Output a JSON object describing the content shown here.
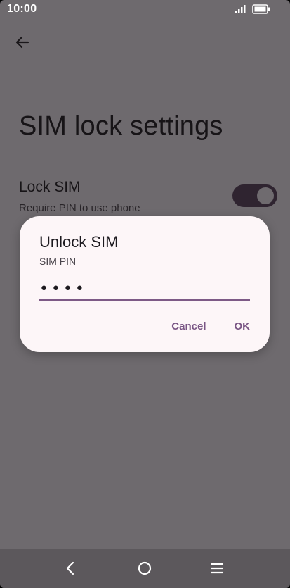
{
  "status_bar": {
    "time": "10:00",
    "icons": [
      "signal-icon",
      "battery-icon"
    ]
  },
  "header": {
    "back_icon": "back-arrow-icon"
  },
  "page": {
    "title": "SIM lock settings"
  },
  "lock_sim": {
    "title": "Lock SIM",
    "summary": "Require PIN to use phone",
    "enabled": true
  },
  "dialog": {
    "title": "Unlock SIM",
    "field_label": "SIM PIN",
    "pin_value": "••••",
    "cancel_label": "Cancel",
    "ok_label": "OK"
  },
  "nav_bar": {
    "icons": [
      "nav-back-icon",
      "nav-home-icon",
      "nav-menu-icon"
    ]
  },
  "colors": {
    "scrim_background": "#6e6a6e",
    "dialog_surface": "#fdf6f8",
    "accent": "#7a5685",
    "toggle_track": "#2f2430"
  }
}
